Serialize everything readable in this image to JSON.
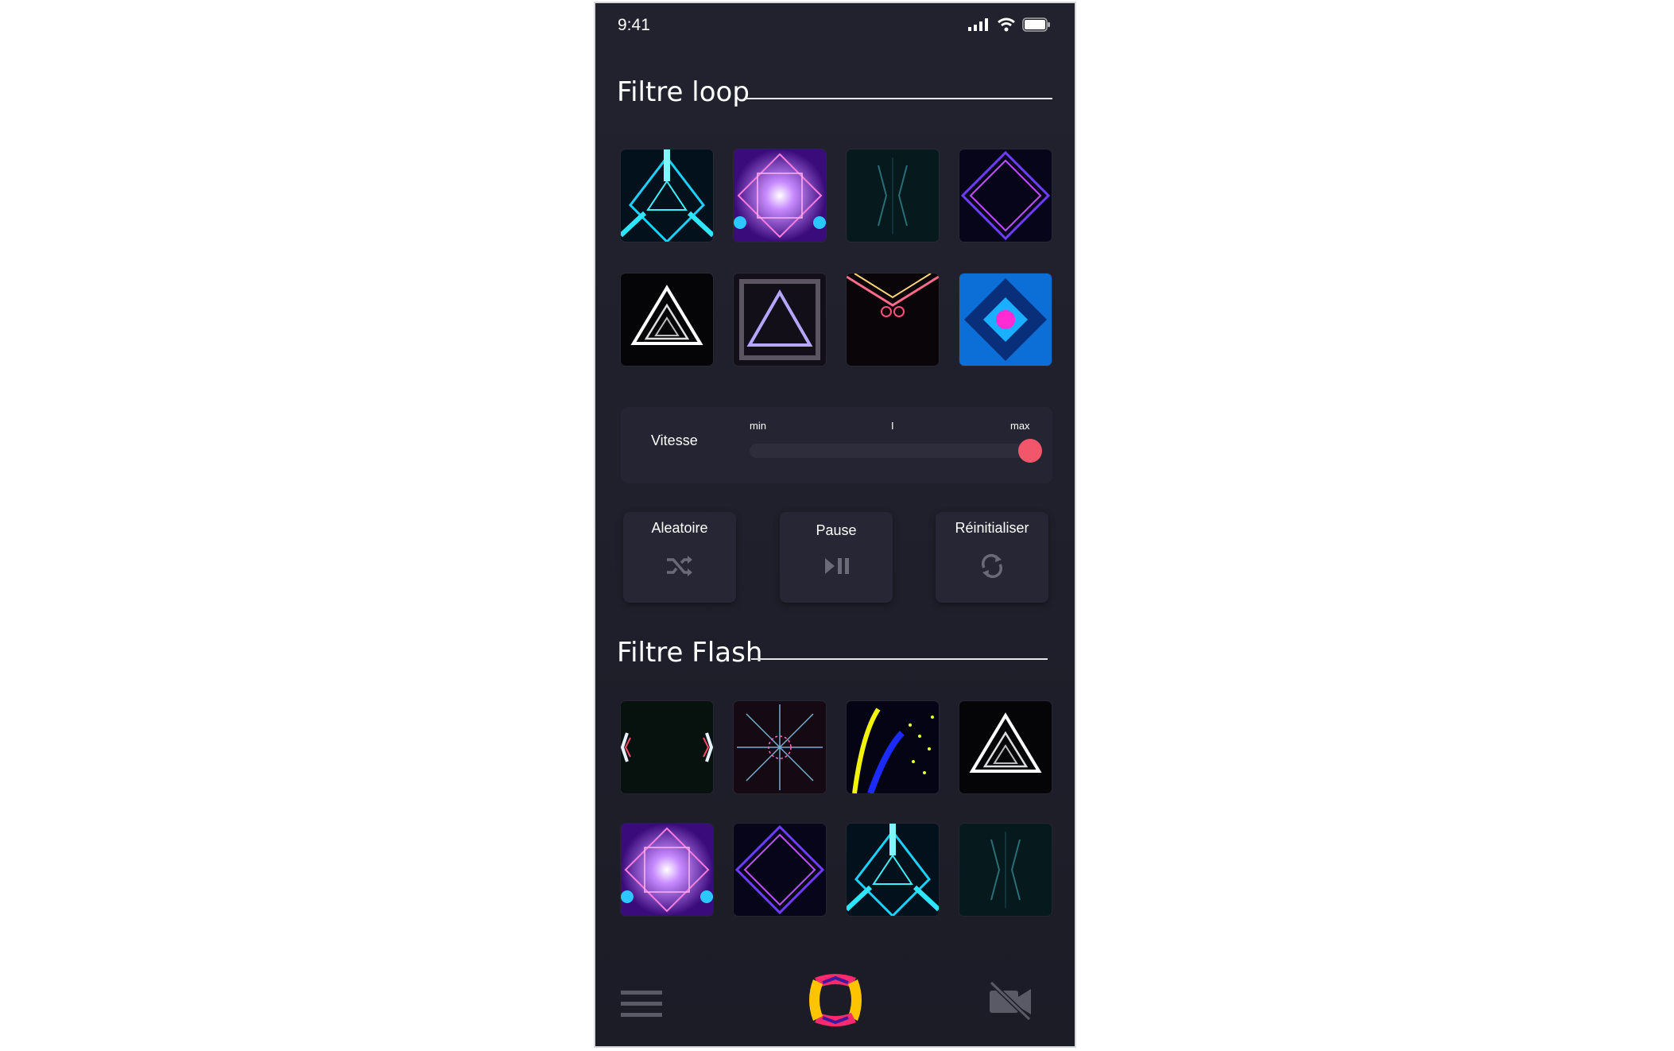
{
  "status_bar": {
    "time": "9:41"
  },
  "loop_section": {
    "title": "Filtre loop"
  },
  "speed": {
    "label": "Vitesse",
    "min_label": "min",
    "mid_label": "I",
    "max_label": "max",
    "level": 0.95
  },
  "controls": {
    "random": {
      "label": "Aleatoire",
      "icon": "shuffle-icon"
    },
    "pause": {
      "label": "Pause",
      "icon": "play-pause-icon"
    },
    "reset": {
      "label": "Réinitialiser",
      "icon": "refresh-icon"
    }
  },
  "flash_section": {
    "title": "Filtre Flash"
  },
  "bottom_nav": {
    "menu_icon": "hamburger-menu-icon",
    "logo": "app-logo",
    "camera_icon": "camera-off-icon"
  },
  "colors": {
    "accent": "#f2566b",
    "background": "#22222f",
    "panel": "#242432"
  }
}
